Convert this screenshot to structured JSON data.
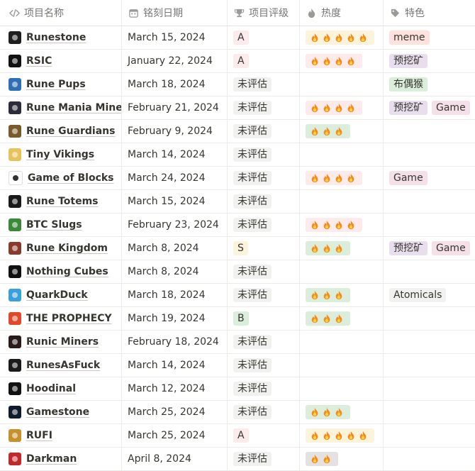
{
  "headers": {
    "name": "项目名称",
    "date": "铭刻日期",
    "rating": "项目评级",
    "heat": "热度",
    "feature": "特色"
  },
  "colors": {
    "rating_A": "#fdebec",
    "rating_S": "#fbf3db",
    "rating_B": "#dbeddb",
    "rating_none": "#f1f1ef",
    "heat_5": "#fbf3db",
    "heat_4": "#fdebec",
    "heat_3": "#dbeddb",
    "heat_2": "#e3e2e0",
    "tag_meme": "#ffe2dd",
    "tag_premine": "#e8deee",
    "tag_game": "#f5e0e9",
    "tag_dog": "#dbeddb",
    "tag_atomicals": "#f1f1ef"
  },
  "rows": [
    {
      "name": "Runestone",
      "avatar_icon": "runestone-icon",
      "avatar_color": "#1f1f1f",
      "date": "March 15, 2024",
      "rating": "A",
      "heat": 5,
      "tags": [
        {
          "label": "meme",
          "kind": "meme"
        }
      ]
    },
    {
      "name": "RSIC",
      "avatar_icon": "rsic-icon",
      "avatar_color": "#111111",
      "date": "January 22, 2024",
      "rating": "A",
      "heat": 4,
      "tags": [
        {
          "label": "预挖矿",
          "kind": "premine"
        }
      ]
    },
    {
      "name": "Rune Pups",
      "avatar_icon": "pup-icon",
      "avatar_color": "#2f6fb5",
      "date": "March 18, 2024",
      "rating": "未评估",
      "heat": 0,
      "tags": [
        {
          "label": "布偶猴",
          "kind": "dog"
        }
      ]
    },
    {
      "name": "Rune Mania Miner",
      "avatar_icon": "miner-icon",
      "avatar_color": "#2b2b3a",
      "date": "February 21, 2024",
      "rating": "未评估",
      "heat": 4,
      "tags": [
        {
          "label": "预挖矿",
          "kind": "premine"
        },
        {
          "label": "Game",
          "kind": "game"
        }
      ]
    },
    {
      "name": "Rune Guardians",
      "avatar_icon": "guardian-icon",
      "avatar_color": "#7a5a2a",
      "date": "February 9, 2024",
      "rating": "未评估",
      "heat": 3,
      "tags": []
    },
    {
      "name": "Tiny Vikings",
      "avatar_icon": "viking-icon",
      "avatar_color": "#e8c25a",
      "date": "March 14, 2024",
      "rating": "未评估",
      "heat": 0,
      "tags": []
    },
    {
      "name": "Game of Blocks",
      "avatar_icon": "blocks-icon",
      "avatar_color": "#ffffff",
      "date": "March 24, 2024",
      "rating": "未评估",
      "heat": 4,
      "tags": [
        {
          "label": "Game",
          "kind": "game"
        }
      ]
    },
    {
      "name": "Rune Totems",
      "avatar_icon": "totem-icon",
      "avatar_color": "#1a1a1a",
      "date": "March 15, 2024",
      "rating": "未评估",
      "heat": 0,
      "tags": []
    },
    {
      "name": "BTC Slugs",
      "avatar_icon": "slug-icon",
      "avatar_color": "#3a8a3a",
      "date": "February 23, 2024",
      "rating": "未评估",
      "heat": 4,
      "tags": []
    },
    {
      "name": "Rune Kingdom",
      "avatar_icon": "kingdom-icon",
      "avatar_color": "#8a3a2a",
      "date": "March 8, 2024",
      "rating": "S",
      "heat": 3,
      "tags": [
        {
          "label": "预挖矿",
          "kind": "premine"
        },
        {
          "label": "Game",
          "kind": "game"
        }
      ]
    },
    {
      "name": "Nothing Cubes",
      "avatar_icon": "cube-icon",
      "avatar_color": "#111111",
      "date": "March 8, 2024",
      "rating": "未评估",
      "heat": 0,
      "tags": []
    },
    {
      "name": "QuarkDuck",
      "avatar_icon": "duck-icon",
      "avatar_color": "#3aa0d8",
      "date": "March 18, 2024",
      "rating": "未评估",
      "heat": 3,
      "tags": [
        {
          "label": "Atomicals",
          "kind": "atomicals"
        }
      ]
    },
    {
      "name": "THE PROPHECY",
      "avatar_icon": "prophecy-icon",
      "avatar_color": "#e04a2a",
      "date": "March 19, 2024",
      "rating": "B",
      "heat": 3,
      "tags": []
    },
    {
      "name": "Runic Miners",
      "avatar_icon": "runic-miner-icon",
      "avatar_color": "#2a1a1a",
      "date": "February 18, 2024",
      "rating": "未评估",
      "heat": 0,
      "tags": []
    },
    {
      "name": "RunesAsFuck",
      "avatar_icon": "runesasfuck-icon",
      "avatar_color": "#1a1a1a",
      "date": "March 14, 2024",
      "rating": "未评估",
      "heat": 0,
      "tags": []
    },
    {
      "name": "Hoodinal",
      "avatar_icon": "hoodinal-icon",
      "avatar_color": "#111111",
      "date": "March 12, 2024",
      "rating": "未评估",
      "heat": 0,
      "tags": []
    },
    {
      "name": "Gamestone",
      "avatar_icon": "gamestone-icon",
      "avatar_color": "#0f1a2a",
      "date": "March 25, 2024",
      "rating": "未评估",
      "heat": 3,
      "tags": []
    },
    {
      "name": "RUFI",
      "avatar_icon": "rufi-icon",
      "avatar_color": "#c8902a",
      "date": "March 25, 2024",
      "rating": "A",
      "heat": 5,
      "tags": []
    },
    {
      "name": "Darkman",
      "avatar_icon": "darkman-icon",
      "avatar_color": "#c02a2a",
      "date": "April 8, 2024",
      "rating": "未评估",
      "heat": 2,
      "tags": []
    }
  ]
}
